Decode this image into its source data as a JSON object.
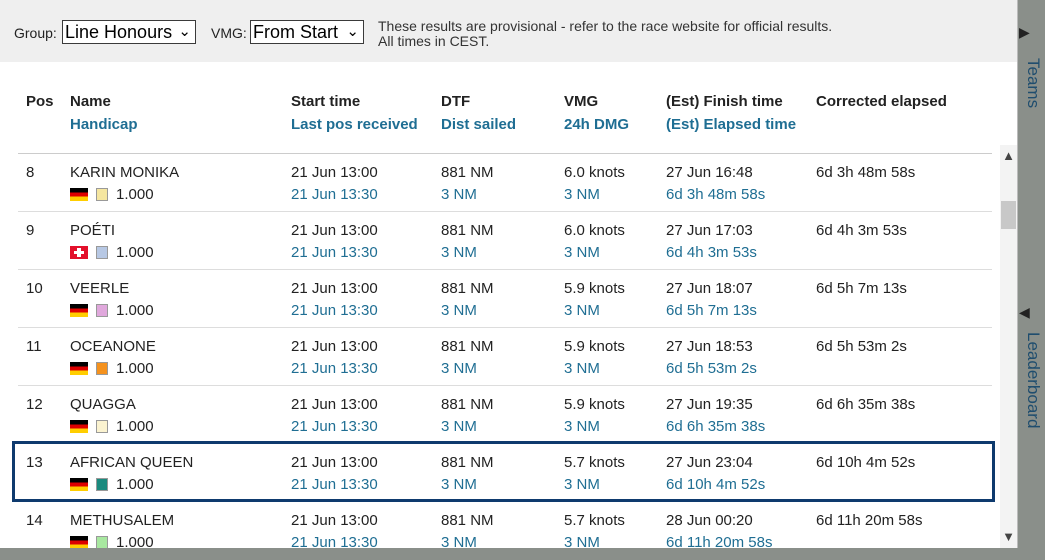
{
  "filters": {
    "group_label": "Group:",
    "group_value": "Line Honours",
    "vmg_label": "VMG:",
    "vmg_value": "From Start",
    "note_line1": "These results are provisional - refer to the race website for official results.",
    "note_line2": "All times in CEST."
  },
  "columns": [
    {
      "top": "Pos",
      "bottom": ""
    },
    {
      "top": "Name",
      "bottom": "Handicap"
    },
    {
      "top": "Start time",
      "bottom": "Last pos received"
    },
    {
      "top": "DTF",
      "bottom": "Dist sailed"
    },
    {
      "top": "VMG",
      "bottom": "24h DMG"
    },
    {
      "top": "(Est) Finish time",
      "bottom": "(Est) Elapsed time"
    },
    {
      "top": "Corrected elapsed",
      "bottom": ""
    }
  ],
  "rows": [
    {
      "pos": "8",
      "name": "KARIN MONIKA",
      "flag": "de",
      "color": "#f5e6a0",
      "handicap": "1.000",
      "start": "21 Jun 13:00",
      "last": "21 Jun 13:30",
      "dtf": "881 NM",
      "sailed": "3 NM",
      "vmg": "6.0 knots",
      "dmg": "3 NM",
      "finish": "27 Jun 16:48",
      "elapsed": "6d 3h 48m 58s",
      "corrected": "6d 3h 48m 58s"
    },
    {
      "pos": "9",
      "name": "POÉTI",
      "flag": "ch",
      "color": "#b7c8e4",
      "handicap": "1.000",
      "start": "21 Jun 13:00",
      "last": "21 Jun 13:30",
      "dtf": "881 NM",
      "sailed": "3 NM",
      "vmg": "6.0 knots",
      "dmg": "3 NM",
      "finish": "27 Jun 17:03",
      "elapsed": "6d 4h 3m 53s",
      "corrected": "6d 4h 3m 53s"
    },
    {
      "pos": "10",
      "name": "VEERLE",
      "flag": "de",
      "color": "#e0a8dc",
      "handicap": "1.000",
      "start": "21 Jun 13:00",
      "last": "21 Jun 13:30",
      "dtf": "881 NM",
      "sailed": "3 NM",
      "vmg": "5.9 knots",
      "dmg": "3 NM",
      "finish": "27 Jun 18:07",
      "elapsed": "6d 5h 7m 13s",
      "corrected": "6d 5h 7m 13s"
    },
    {
      "pos": "11",
      "name": "OCEANONE",
      "flag": "de",
      "color": "#f5921e",
      "handicap": "1.000",
      "start": "21 Jun 13:00",
      "last": "21 Jun 13:30",
      "dtf": "881 NM",
      "sailed": "3 NM",
      "vmg": "5.9 knots",
      "dmg": "3 NM",
      "finish": "27 Jun 18:53",
      "elapsed": "6d 5h 53m 2s",
      "corrected": "6d 5h 53m 2s"
    },
    {
      "pos": "12",
      "name": "QUAGGA",
      "flag": "de",
      "color": "#fbf3d0",
      "handicap": "1.000",
      "start": "21 Jun 13:00",
      "last": "21 Jun 13:30",
      "dtf": "881 NM",
      "sailed": "3 NM",
      "vmg": "5.9 knots",
      "dmg": "3 NM",
      "finish": "27 Jun 19:35",
      "elapsed": "6d 6h 35m 38s",
      "corrected": "6d 6h 35m 38s"
    },
    {
      "pos": "13",
      "name": "AFRICAN QUEEN",
      "flag": "de",
      "color": "#1a8a7e",
      "handicap": "1.000",
      "start": "21 Jun 13:00",
      "last": "21 Jun 13:30",
      "dtf": "881 NM",
      "sailed": "3 NM",
      "vmg": "5.7 knots",
      "dmg": "3 NM",
      "finish": "27 Jun 23:04",
      "elapsed": "6d 10h 4m 52s",
      "corrected": "6d 10h 4m 52s"
    },
    {
      "pos": "14",
      "name": "METHUSALEM",
      "flag": "de",
      "color": "#a8e8a0",
      "handicap": "1.000",
      "start": "21 Jun 13:00",
      "last": "21 Jun 13:30",
      "dtf": "881 NM",
      "sailed": "3 NM",
      "vmg": "5.7 knots",
      "dmg": "3 NM",
      "finish": "28 Jun 00:20",
      "elapsed": "6d 11h 20m 58s",
      "corrected": "6d 11h 20m 58s"
    }
  ],
  "side_tabs": {
    "teams": "Teams",
    "leaderboard": "Leaderboard"
  }
}
